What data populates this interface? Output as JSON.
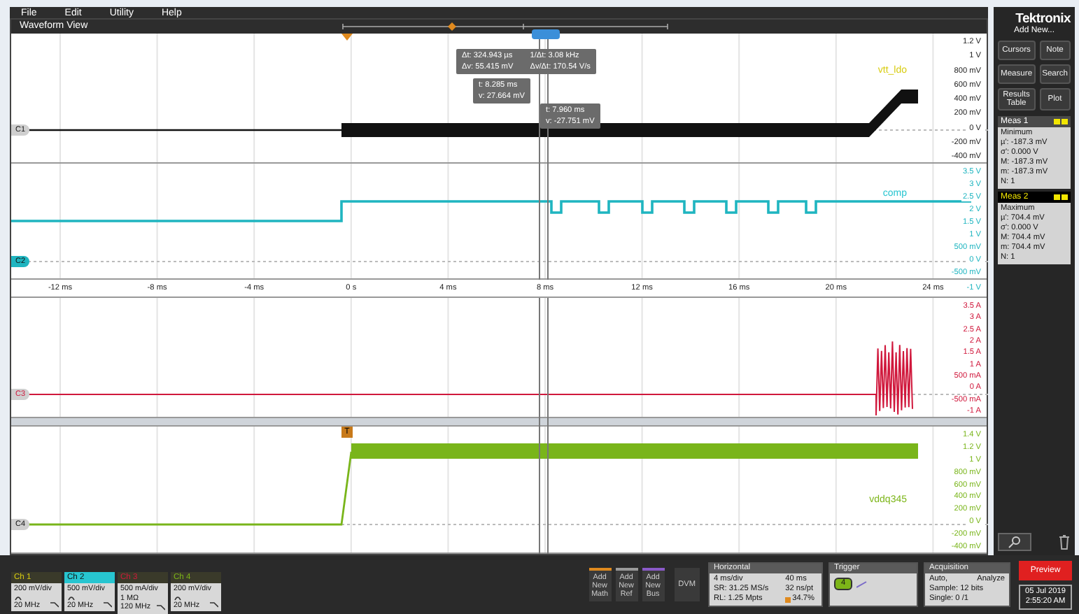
{
  "menu": [
    {
      "label": "File"
    },
    {
      "label": "Edit"
    },
    {
      "label": "Utility"
    },
    {
      "label": "Help"
    }
  ],
  "waveform_view": {
    "title": "Waveform View"
  },
  "cursor_readouts": {
    "delta": [
      "Δt: 324.943 µs",
      "1/Δt: 3.08 kHz",
      "Δv: 55.415 mV",
      "Δv/Δt: 170.54 V/s"
    ],
    "cursor_a": [
      "t: 8.285 ms",
      "v: 27.664 mV"
    ],
    "cursor_b": [
      "t: 7.960 ms",
      "v: -27.751 mV"
    ]
  },
  "panels": [
    {
      "channel": "C1",
      "color": "#111111",
      "trace_label": "vtt_ldo",
      "scale": [
        "1.2 V",
        "1 V",
        "800 mV",
        "600 mV",
        "400 mV",
        "200 mV",
        "0 V",
        "-200 mV",
        "-400 mV"
      ]
    },
    {
      "channel": "C2",
      "color": "#1fb5c0",
      "trace_label": "comp",
      "scale": [
        "3.5 V",
        "3 V",
        "2.5 V",
        "2 V",
        "1.5 V",
        "1 V",
        "500 mV",
        "0 V",
        "-500 mV"
      ]
    },
    {
      "channel": "C3",
      "color": "#d0183c",
      "scale": [
        "3.5 A",
        "3 A",
        "2.5 A",
        "2 A",
        "1.5 A",
        "1 A",
        "500 mA",
        "0 A",
        "-500 mA",
        "-1 A"
      ]
    },
    {
      "channel": "C4",
      "color": "#79b51a",
      "trace_label": "vddq345",
      "scale": [
        "1.4 V",
        "1.2 V",
        "1 V",
        "800 mV",
        "600 mV",
        "400 mV",
        "200 mV",
        "0 V",
        "-200 mV",
        "-400 mV"
      ]
    }
  ],
  "time_axis": {
    "labels": [
      "-12 ms",
      "-8 ms",
      "-4 ms",
      "0 s",
      "4 ms",
      "8 ms",
      "12 ms",
      "16 ms",
      "20 ms",
      "24 ms"
    ],
    "scale_end": "-1 V"
  },
  "trigger_marker": "T",
  "right_panel": {
    "logo": "Tektronix",
    "add_new": "Add New...",
    "buttons": [
      {
        "label": "Cursors"
      },
      {
        "label": "Note"
      },
      {
        "label": "Measure"
      },
      {
        "label": "Search"
      },
      {
        "label": "Results Table"
      },
      {
        "label": "Plot"
      }
    ],
    "measurements": [
      {
        "title": "Meas 1",
        "selected": false,
        "lines": [
          "Minimum",
          "µ': -187.3 mV",
          "σ': 0.000 V",
          "M: -187.3 mV",
          "m: -187.3 mV",
          "N: 1"
        ]
      },
      {
        "title": "Meas 2",
        "selected": true,
        "lines": [
          "Maximum",
          "µ': 704.4 mV",
          "σ': 0.000 V",
          "M: 704.4 mV",
          "m: 704.4 mV",
          "N: 1"
        ]
      }
    ]
  },
  "channels": [
    {
      "label": "Ch 1",
      "color": "#d8cc10",
      "scale": "200 mV/div",
      "bandwidth": "20 MHz"
    },
    {
      "label": "Ch 2",
      "color": "#27c5d0",
      "scale": "500 mV/div",
      "bandwidth": "20 MHz"
    },
    {
      "label": "Ch 3",
      "color": "#d0183c",
      "scale": "500 mA/div",
      "coupling": "1 MΩ",
      "bandwidth": "120 MHz"
    },
    {
      "label": "Ch 4",
      "color": "#7cb518",
      "scale": "200 mV/div",
      "bandwidth": "20 MHz"
    }
  ],
  "add_buttons": [
    {
      "lines": [
        "Add",
        "New",
        "Math"
      ],
      "color": "#e08a1e"
    },
    {
      "lines": [
        "Add",
        "New",
        "Ref"
      ],
      "color": "#9a9a9a"
    },
    {
      "lines": [
        "Add",
        "New",
        "Bus"
      ],
      "color": "#8a5ac8"
    }
  ],
  "dvm": "DVM",
  "horizontal": {
    "title": "Horizontal",
    "cells": [
      "4 ms/div",
      "40 ms",
      "SR: 31.25 MS/s",
      "32 ns/pt",
      "RL: 1.25 Mpts",
      "34.7%"
    ]
  },
  "trigger": {
    "title": "Trigger",
    "source": "4"
  },
  "acquisition": {
    "title": "Acquisition",
    "cells": [
      "Auto,",
      "Analyze"
    ],
    "lines": [
      "Sample: 12 bits",
      "Single: 0 /1"
    ]
  },
  "preview": "Preview",
  "date": [
    "05 Jul 2019",
    "2:55:20 AM"
  ]
}
